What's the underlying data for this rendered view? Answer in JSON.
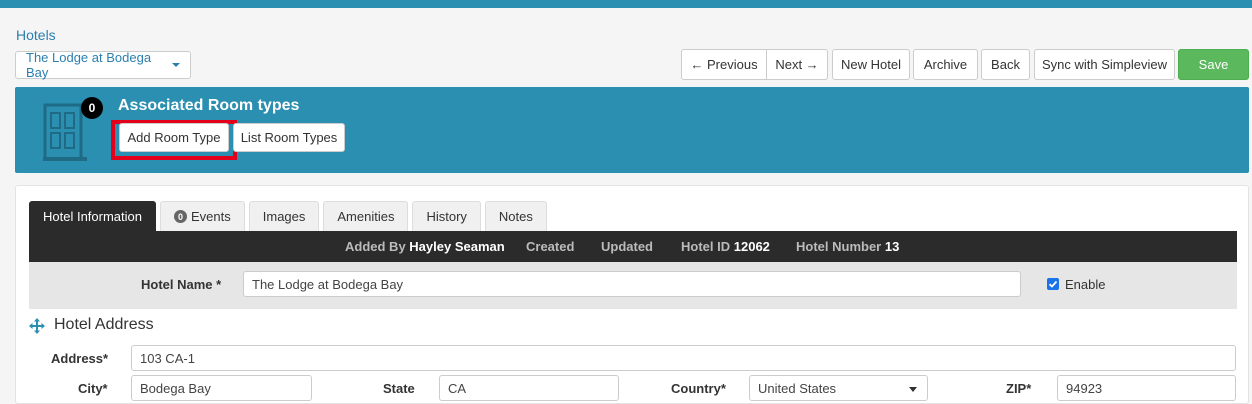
{
  "breadcrumb": {
    "label": "Hotels"
  },
  "hotel_select": {
    "value": "The Lodge at Bodega Bay"
  },
  "toolbar": {
    "previous_label": "← Previous",
    "next_label": "Next →",
    "new_hotel_label": "New Hotel",
    "archive_label": "Archive",
    "back_label": "Back",
    "sync_label": "Sync with Simpleview",
    "save_label": "Save"
  },
  "banner": {
    "count": "0",
    "title": "Associated Room types",
    "add_label": "Add Room Type",
    "list_label": "List Room Types",
    "door_icon": "door-icon"
  },
  "tabs": [
    {
      "label": "Hotel Information",
      "active": true
    },
    {
      "label": "Events",
      "badge": "0"
    },
    {
      "label": "Images"
    },
    {
      "label": "Amenities"
    },
    {
      "label": "History"
    },
    {
      "label": "Notes"
    }
  ],
  "meta": {
    "added_by_label": "Added By",
    "added_by_value": "Hayley Seaman",
    "created_label": "Created",
    "updated_label": "Updated",
    "hotel_id_label": "Hotel ID",
    "hotel_id_value": "12062",
    "hotel_number_label": "Hotel Number",
    "hotel_number_value": "13"
  },
  "form": {
    "hotel_name_label": "Hotel Name *",
    "hotel_name_value": "The Lodge at Bodega Bay",
    "enable_label": "Enable",
    "section_title": "Hotel Address",
    "address_label": "Address*",
    "address_value": "103 CA-1",
    "city_label": "City*",
    "city_value": "Bodega Bay",
    "state_label": "State",
    "state_value": "CA",
    "country_label": "Country*",
    "country_value": "United States",
    "zip_label": "ZIP*",
    "zip_value": "94923"
  },
  "colors": {
    "accent": "#2a8fb0",
    "save": "#5cb85c",
    "highlight": "#e3001b",
    "dark_bar": "#2b2b2b"
  }
}
